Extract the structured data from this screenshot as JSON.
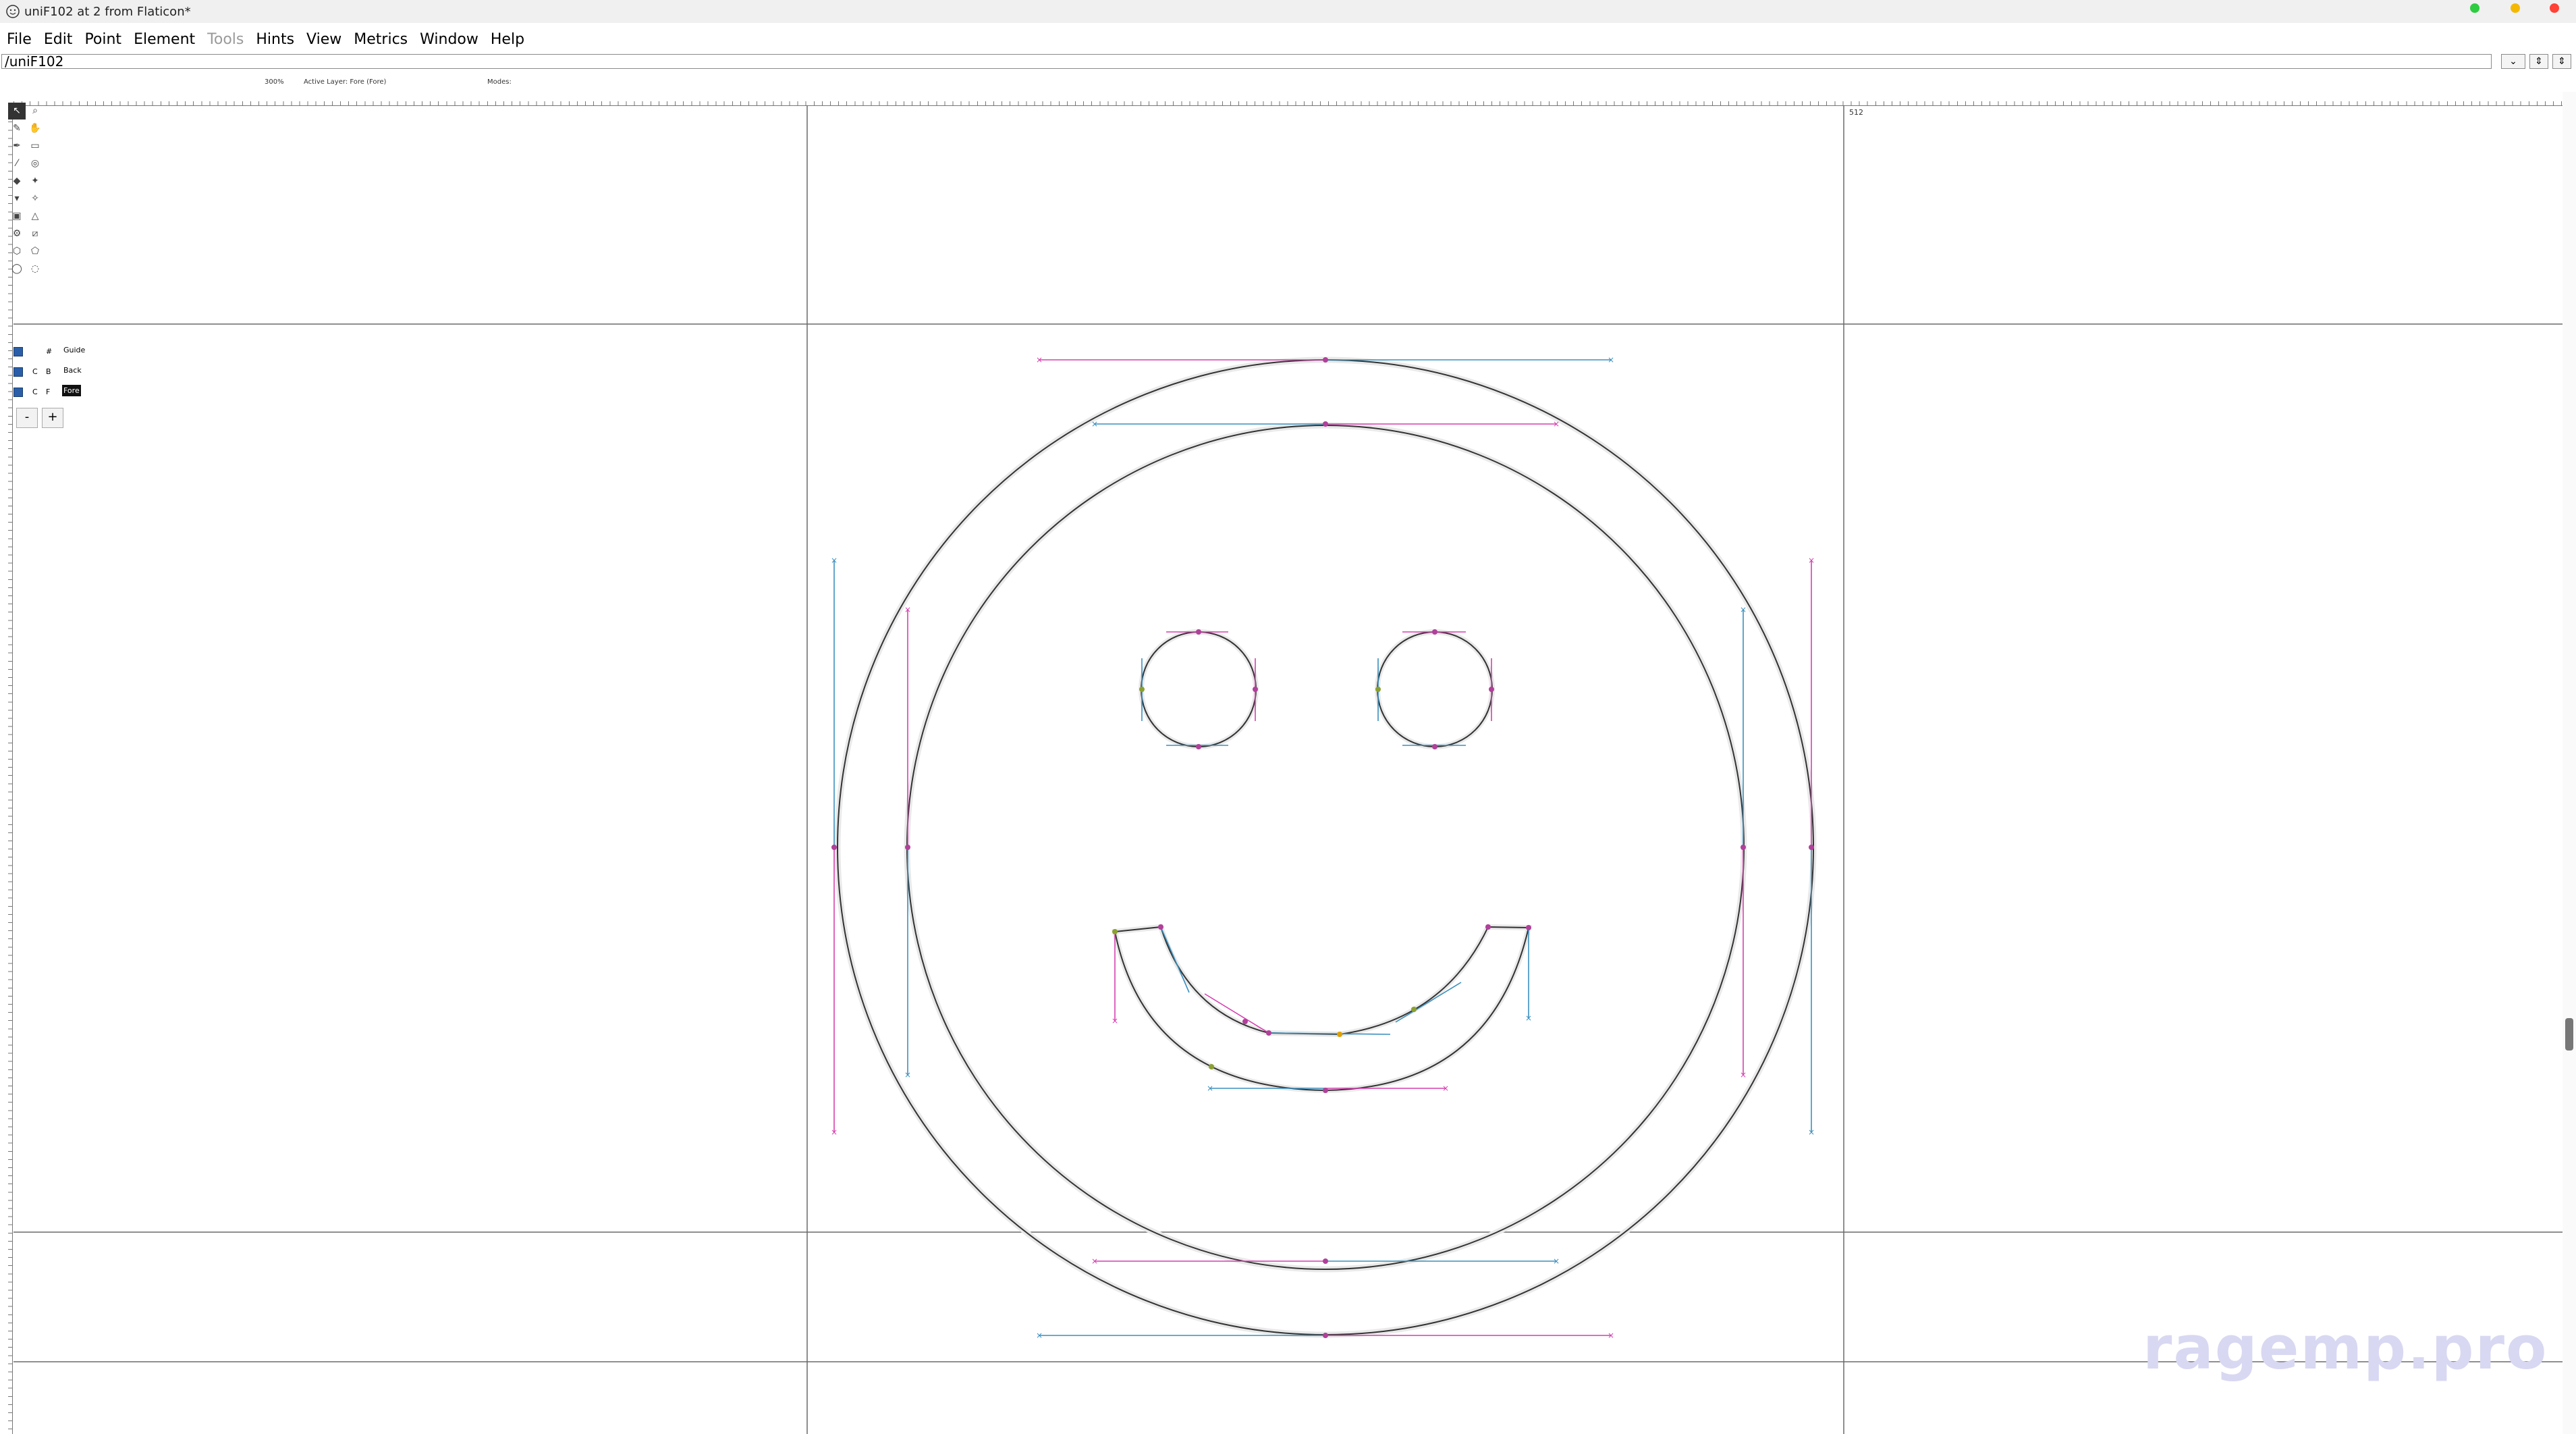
{
  "window": {
    "title": "uniF102 at 2 from Flaticon*",
    "controls": {
      "green": "#2ecc40",
      "yellow": "#f5b800",
      "red": "#ff4136"
    }
  },
  "menu": [
    "File",
    "Edit",
    "Point",
    "Element",
    "Tools",
    "Hints",
    "View",
    "Metrics",
    "Window",
    "Help"
  ],
  "menu_disabled": [
    "Tools"
  ],
  "glyph_field": {
    "value": "/uniF102"
  },
  "status": {
    "zoom": "300%",
    "active_layer": "Active Layer: Fore (Fore)",
    "modes": "Modes:"
  },
  "ruler": {
    "width_mark": "512"
  },
  "layers": [
    {
      "q": "",
      "t": "#",
      "name": "Guide",
      "selected": false
    },
    {
      "q": "C",
      "t": "B",
      "name": "Back",
      "selected": false
    },
    {
      "q": "C",
      "t": "F",
      "name": "Fore",
      "selected": true
    }
  ],
  "layer_buttons": {
    "remove": "-",
    "add": "+"
  },
  "tools": [
    "pointer-icon",
    "magnify-icon",
    "pencil-icon",
    "hand-icon",
    "pen-icon",
    "ruler-icon",
    "knife-icon",
    "rotate-icon",
    "curve-point-icon",
    "hv-curve-icon",
    "corner-point-icon",
    "tangent-point-icon",
    "scale-icon",
    "rotate3d-icon",
    "flip-icon",
    "skew-icon",
    "perspective-icon",
    "rectangle-icon",
    "ellipse-icon",
    "polygon-icon"
  ],
  "colors": {
    "outline": "#333333",
    "handle_magenta": "#d63fb0",
    "handle_cyan": "#3a8fbf",
    "guide": "#6a6a6a",
    "watermark": "#d8d8f2"
  },
  "watermark": "ragemp.pro"
}
